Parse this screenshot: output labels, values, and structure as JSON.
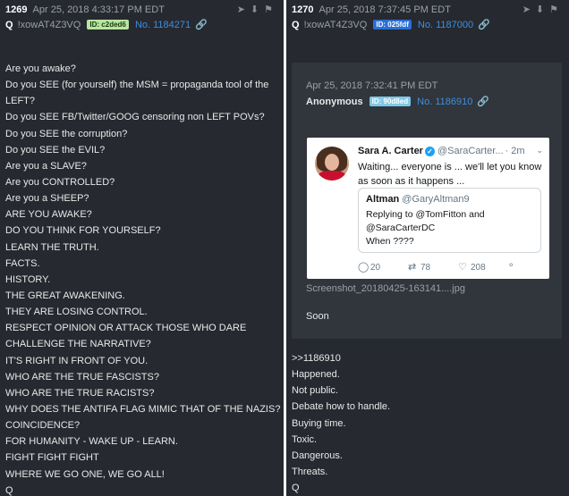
{
  "left_post": {
    "number": "1269",
    "date": "Apr 25, 2018 4:33:17 PM EDT",
    "name": "Q",
    "tripcode": "!xowAT4Z3VQ",
    "id": "ID: c2ded6",
    "post_no": "No. 1184271",
    "lines": [
      "Are you awake?",
      "Do you SEE (for yourself) the MSM = propaganda tool of the",
      "LEFT?",
      "Do you SEE FB/Twitter/GOOG censoring non LEFT POVs?",
      "Do you SEE the corruption?",
      "Do you SEE the EVIL?",
      "Are you a SLAVE?",
      "Are you CONTROLLED?",
      "Are you a SHEEP?",
      "ARE YOU AWAKE?",
      "DO YOU THINK FOR YOURSELF?",
      "LEARN THE TRUTH.",
      "FACTS.",
      "HISTORY.",
      "THE GREAT AWAKENING.",
      "THEY ARE LOSING CONTROL.",
      "RESPECT OPINION OR ATTACK THOSE WHO DARE",
      "CHALLENGE THE NARRATIVE?",
      "IT'S RIGHT IN FRONT OF YOU.",
      "WHO ARE THE TRUE FASCISTS?",
      "WHO ARE THE TRUE RACISTS?",
      "WHY DOES THE ANTIFA FLAG MIMIC THAT OF THE NAZIS?",
      "COINCIDENCE?",
      "FOR HUMANITY - WAKE UP - LEARN.",
      "FIGHT FIGHT FIGHT",
      "WHERE WE GO ONE, WE GO ALL!",
      "Q"
    ]
  },
  "right_post": {
    "number": "1270",
    "date": "Apr 25, 2018 7:37:45 PM EDT",
    "name": "Q",
    "tripcode": "!xowAT4Z3VQ",
    "id": "ID: 025fdf",
    "post_no": "No. 1187000",
    "quoted": {
      "date": "Apr 25, 2018 7:32:41 PM EDT",
      "author": "Anonymous",
      "id": "ID: 90d8ed",
      "post_no": "No. 1186910",
      "tweet": {
        "name": "Sara A. Carter",
        "handle": "@SaraCarter...",
        "time": "· 2m",
        "text": "Waiting... everyone is ... we'll let you know as soon as it happens ...",
        "quoted_name": "Altman",
        "quoted_handle": "@GaryAltman9",
        "quoted_reply": "Replying to @TomFitton and @SaraCarterDC",
        "quoted_text": "When ????",
        "replies": "20",
        "retweets": "78",
        "likes": "208"
      },
      "filename": "Screenshot_20180425-163141....jpg",
      "text": "Soon"
    },
    "lines": [
      ">>1186910",
      "Happened.",
      "Not public.",
      "Debate how to handle.",
      "Buying time.",
      "Toxic.",
      "Dangerous.",
      "Threats.",
      "Q"
    ]
  },
  "colors": {
    "panel_bg": "#26292f",
    "quote_bg": "#31353c",
    "link": "#3d8fe0",
    "id_left": "#b8e6a0",
    "id_right": "#2a6fd6",
    "id_quoted": "#7fc8e8"
  },
  "icons": [
    "share-icon",
    "download-icon",
    "bookmark-icon",
    "link-icon",
    "reply-icon",
    "retweet-icon",
    "like-icon",
    "dm-icon",
    "verified-icon"
  ]
}
